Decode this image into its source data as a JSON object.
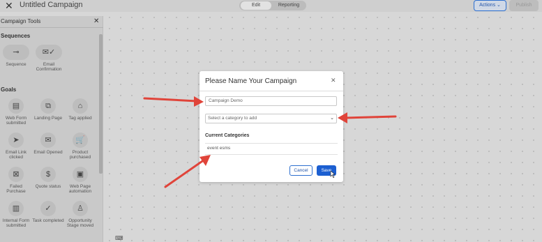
{
  "header": {
    "title": "Untitled Campaign",
    "mode_tabs": [
      "Edit",
      "Reporting"
    ],
    "actions_label": "Actions ⌄",
    "publish_label": "Publish"
  },
  "sidebar": {
    "title": "Campaign Tools",
    "sequences_heading": "Sequences",
    "sequences": [
      {
        "label": "Sequence",
        "icon": "sequence-icon"
      },
      {
        "label": "Email Confirmation",
        "icon": "email-confirmation-icon"
      }
    ],
    "goals_heading": "Goals",
    "goals": [
      {
        "label": "Web Form submitted",
        "icon": "web-form-icon"
      },
      {
        "label": "Landing Page",
        "icon": "landing-page-icon"
      },
      {
        "label": "Tag applied",
        "icon": "tag-icon"
      },
      {
        "label": "Email Link clicked",
        "icon": "cursor-icon"
      },
      {
        "label": "Email Opened",
        "icon": "email-opened-icon"
      },
      {
        "label": "Product purchased",
        "icon": "cart-icon"
      },
      {
        "label": "Failed Purchase",
        "icon": "failed-purchase-icon"
      },
      {
        "label": "Quote status",
        "icon": "dollar-icon"
      },
      {
        "label": "Web Page automation",
        "icon": "web-page-icon"
      },
      {
        "label": "Internal Form submitted",
        "icon": "internal-form-icon"
      },
      {
        "label": "Task completed",
        "icon": "check-icon"
      },
      {
        "label": "Opportunity Stage moved",
        "icon": "opportunity-icon"
      }
    ]
  },
  "modal": {
    "title": "Please Name Your Campaign",
    "name_value": "Campaign Demo",
    "category_placeholder": "Select a category to add",
    "current_categories_label": "Current Categories",
    "categories": [
      "event esms"
    ],
    "cancel_label": "Cancel",
    "save_label": "Save"
  },
  "colors": {
    "accent": "#1c5fd1",
    "arrow": "#e0443a"
  }
}
